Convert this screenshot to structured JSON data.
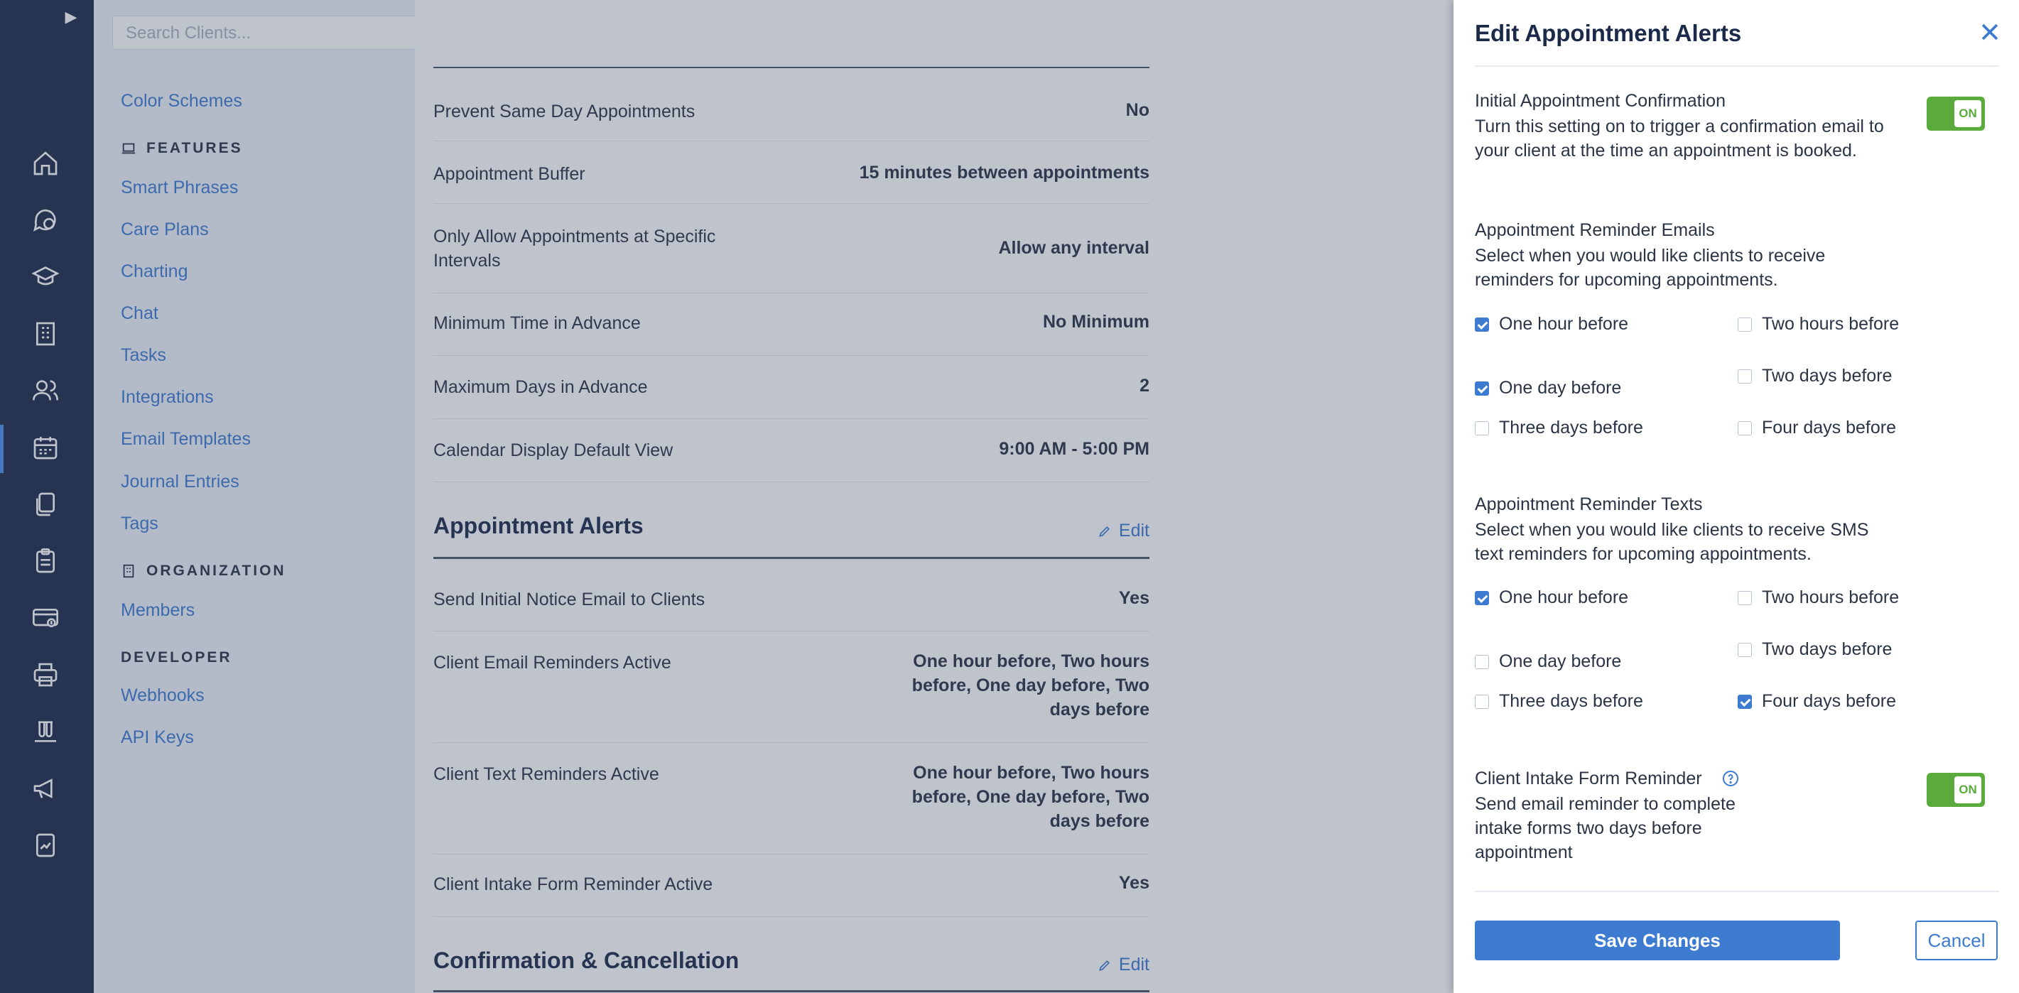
{
  "search": {
    "placeholder": "Search Clients..."
  },
  "rail": {
    "icons": [
      "home-icon",
      "chat-icon",
      "graduation-cap-icon",
      "building-icon",
      "users-icon",
      "calendar-icon",
      "documents-icon",
      "clipboard-icon",
      "billing-card-icon",
      "printer-icon",
      "vials-icon",
      "megaphone-icon",
      "report-icon"
    ],
    "active": "calendar-icon"
  },
  "sidebar": {
    "top_items": [
      "Color Schemes"
    ],
    "features_heading": "FEATURES",
    "features_items": [
      "Smart Phrases",
      "Care Plans",
      "Charting",
      "Chat",
      "Tasks",
      "Integrations",
      "Email Templates",
      "Journal Entries",
      "Tags"
    ],
    "organization_heading": "ORGANIZATION",
    "organization_items": [
      "Members"
    ],
    "developer_heading": "DEVELOPER",
    "developer_items": [
      "Webhooks",
      "API Keys"
    ]
  },
  "main": {
    "booking_rows": [
      {
        "label": "Prevent Same Day Appointments",
        "value": "No"
      },
      {
        "label": "Appointment Buffer",
        "value": "15 minutes between appointments"
      },
      {
        "label": "Only Allow Appointments at Specific Intervals",
        "value": "Allow any interval"
      },
      {
        "label": "Minimum Time in Advance",
        "value": "No Minimum"
      },
      {
        "label": "Maximum Days in Advance",
        "value": "2"
      },
      {
        "label": "Calendar Display Default View",
        "value": "9:00 AM - 5:00 PM"
      }
    ],
    "alerts_title": "Appointment Alerts",
    "edit_label": "Edit",
    "alerts_rows": [
      {
        "label": "Send Initial Notice Email to Clients",
        "value": "Yes"
      },
      {
        "label": "Client Email Reminders Active",
        "value": "One hour before, Two hours before, One day before, Two days before"
      },
      {
        "label": "Client Text Reminders Active",
        "value": "One hour before, Two hours before, One day before, Two days before"
      },
      {
        "label": "Client Intake Form Reminder Active",
        "value": "Yes"
      }
    ],
    "confirmation_title": "Confirmation & Cancellation"
  },
  "panel": {
    "title": "Edit Appointment Alerts",
    "initial": {
      "label": "Initial Appointment Confirmation",
      "description": "Turn this setting on to trigger a confirmation email to your client at the time an appointment is booked.",
      "toggle": "ON"
    },
    "emails": {
      "label": "Appointment Reminder Emails",
      "description": "Select when you would like clients to receive reminders for upcoming appointments.",
      "options": [
        {
          "label": "One hour before",
          "checked": true
        },
        {
          "label": "Two hours before",
          "checked": false
        },
        {
          "label": "One day before",
          "checked": true
        },
        {
          "label": "Two days before",
          "checked": false
        },
        {
          "label": "Three days before",
          "checked": false
        },
        {
          "label": "Four days before",
          "checked": false
        }
      ]
    },
    "texts": {
      "label": "Appointment Reminder Texts",
      "description": "Select when you would like clients to receive SMS text reminders for upcoming appointments.",
      "options": [
        {
          "label": "One hour before",
          "checked": true
        },
        {
          "label": "Two hours before",
          "checked": false
        },
        {
          "label": "One day before",
          "checked": false
        },
        {
          "label": "Two days before",
          "checked": false
        },
        {
          "label": "Three days before",
          "checked": false
        },
        {
          "label": "Four days before",
          "checked": true
        }
      ]
    },
    "intake": {
      "label": "Client Intake Form Reminder",
      "description": "Send email reminder to complete intake forms two days before appointment",
      "toggle": "ON"
    },
    "save_label": "Save Changes",
    "cancel_label": "Cancel"
  }
}
